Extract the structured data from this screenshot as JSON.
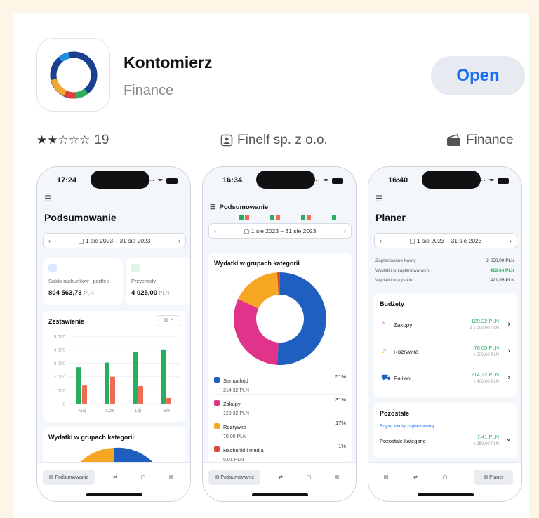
{
  "app": {
    "name": "Kontomierz",
    "category": "Finance",
    "open_label": "Open"
  },
  "meta": {
    "stars": "★★☆☆☆",
    "rating_count": "19",
    "developer": "Finelf sp. z o.o.",
    "genre": "Finance"
  },
  "screens": [
    {
      "time": "17:24",
      "title": "Podsumowanie",
      "date_range": "1 sie 2023 – 31 sie 2023",
      "balance": {
        "label": "Saldo rachunków i portfeli",
        "value": "804 563,73",
        "currency": "PLN"
      },
      "income": {
        "label": "Przychody",
        "value": "4 025,00",
        "currency": "PLN"
      },
      "chart_title": "Zestawienie",
      "next_title": "Wydatki w grupach kategorii",
      "nav_active": "Podsumowanie"
    },
    {
      "time": "16:34",
      "header": "Podsumowanie",
      "date_range": "1 sie 2023 – 31 sie 2023",
      "donut_title": "Wydatki w grupach kategorii",
      "nav_active": "Podsumowanie"
    },
    {
      "time": "16:40",
      "title": "Planer",
      "date_range": "1 sie 2023 – 31 sie 2023",
      "summary": [
        {
          "label": "Zaplanowane kwoty",
          "value": "2 650,00 PLN"
        },
        {
          "label": "Wydatki w zaplanowanych",
          "value": "413,64 PLN"
        },
        {
          "label": "Wydatki wszystkie",
          "value": "421,05 PLN"
        }
      ],
      "budgets_title": "Budżety",
      "budgets": [
        {
          "icon": "shopping-bag-icon",
          "name": "Zakupy",
          "spent": "129,32 PLN",
          "of": "z 1 000,00 PLN"
        },
        {
          "icon": "music-note-icon",
          "name": "Rozrywka",
          "spent": "70,00 PLN",
          "of": "z 500,00 PLN"
        },
        {
          "icon": "car-icon",
          "name": "Paliwo",
          "spent": "214,32 PLN",
          "of": "z 400,00 PLN"
        }
      ],
      "other_title": "Pozostałe",
      "edit_link": "Edytuj kwotę zaplanowaną",
      "other_row": {
        "label": "Pozostałe kategorie",
        "spent": "7,41 PLN",
        "of": "z 250,00 PLN"
      },
      "nav_active": "Planer"
    }
  ],
  "chart_data": [
    {
      "type": "bar",
      "title": "Zestawienie",
      "categories": [
        "Maj",
        "Cze",
        "Lip",
        "Sie"
      ],
      "yticks": [
        "0",
        "1 000",
        "2 000",
        "3 000",
        "4 000",
        "5 000"
      ],
      "ylim": [
        0,
        5000
      ],
      "series": [
        {
          "color": "#27ae60",
          "values": [
            2700,
            3050,
            3850,
            4025
          ]
        },
        {
          "color": "#ef6b55",
          "values": [
            1350,
            2000,
            1300,
            420
          ]
        }
      ]
    },
    {
      "type": "pie",
      "title": "Wydatki w grupach kategorii",
      "slices": [
        {
          "name": "Samochód",
          "amount": "214,32 PLN",
          "percent": "51%",
          "value": 51,
          "color": "#1f5fbf"
        },
        {
          "name": "Zakupy",
          "amount": "129,32 PLN",
          "percent": "31%",
          "value": 31,
          "color": "#e0338a"
        },
        {
          "name": "Rozrywka",
          "amount": "70,00 PLN",
          "percent": "17%",
          "value": 17,
          "color": "#f5a623"
        },
        {
          "name": "Rachunki i media",
          "amount": "5,01 PLN",
          "percent": "1%",
          "value": 1,
          "color": "#d84b3a"
        }
      ]
    }
  ]
}
